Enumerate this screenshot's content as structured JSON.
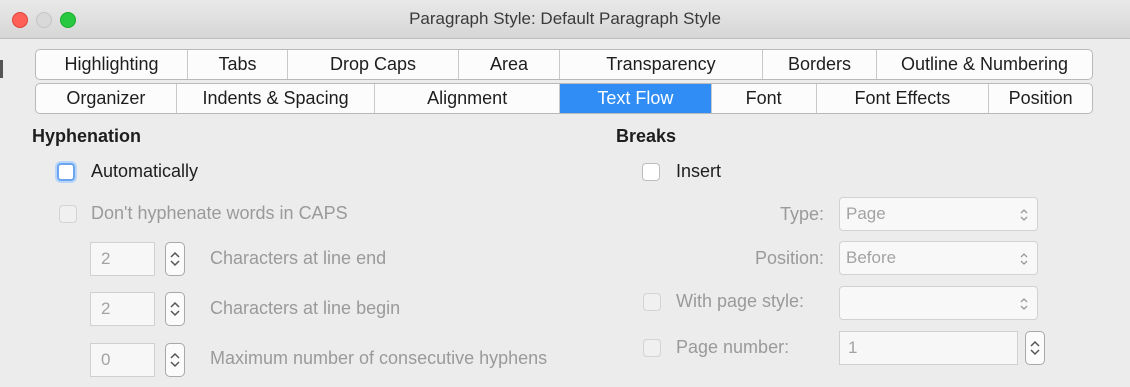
{
  "window": {
    "title": "Paragraph Style: Default Paragraph Style"
  },
  "tabs": {
    "row1": [
      "Highlighting",
      "Tabs",
      "Drop Caps",
      "Area",
      "Transparency",
      "Borders",
      "Outline & Numbering"
    ],
    "row2": [
      "Organizer",
      "Indents & Spacing",
      "Alignment",
      "Text Flow",
      "Font",
      "Font Effects",
      "Position"
    ],
    "active": "Text Flow"
  },
  "hyphenation": {
    "title": "Hyphenation",
    "automatically": "Automatically",
    "dont_hyphenate_caps": "Don't hyphenate words in CAPS",
    "chars_line_end": {
      "value": "2",
      "label": "Characters at line end"
    },
    "chars_line_begin": {
      "value": "2",
      "label": "Characters at line begin"
    },
    "max_hyphens": {
      "value": "0",
      "label": "Maximum number of consecutive hyphens"
    }
  },
  "breaks": {
    "title": "Breaks",
    "insert": "Insert",
    "type": {
      "label": "Type:",
      "value": "Page"
    },
    "position": {
      "label": "Position:",
      "value": "Before"
    },
    "with_page_style": {
      "label": "With page style:",
      "value": ""
    },
    "page_number": {
      "label": "Page number:",
      "value": "1"
    }
  },
  "colors": {
    "accent": "#2f8df5",
    "close": "#fe5f57",
    "maximize": "#28c840"
  }
}
